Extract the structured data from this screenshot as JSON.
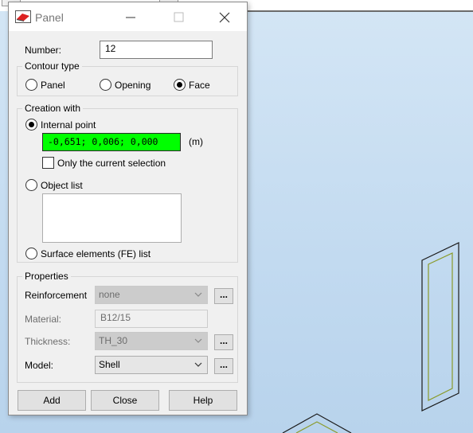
{
  "dialog": {
    "title": "Panel",
    "number_label": "Number:",
    "number_value": "12",
    "contour_type": {
      "legend": "Contour type",
      "options": [
        "Panel",
        "Opening",
        "Face"
      ],
      "selected": "Face"
    },
    "creation": {
      "legend": "Creation with",
      "internal_point_label": "Internal point",
      "internal_point_value": "-0,651; 0,006; 0,000",
      "unit": "(m)",
      "only_current_selection_label": "Only the current selection",
      "only_current_selection_checked": false,
      "object_list_label": "Object list",
      "fe_list_label": "Surface elements (FE) list",
      "selected": "Internal point"
    },
    "properties": {
      "legend": "Properties",
      "reinforcement_label": "Reinforcement",
      "reinforcement_value": "none",
      "material_label": "Material:",
      "material_value": "B12/15",
      "thickness_label": "Thickness:",
      "thickness_value": "TH_30",
      "model_label": "Model:",
      "model_value": "Shell",
      "more_label": "..."
    },
    "buttons": {
      "add": "Add",
      "close": "Close",
      "help": "Help"
    }
  },
  "colors": {
    "point_field_bg": "#00ff00",
    "workspace_bg": "#c8def2",
    "model_edge": "#8a9a2a"
  },
  "icons": [
    "panel-app-icon",
    "minimize-icon",
    "maximize-icon",
    "close-icon",
    "chevron-down-icon"
  ]
}
